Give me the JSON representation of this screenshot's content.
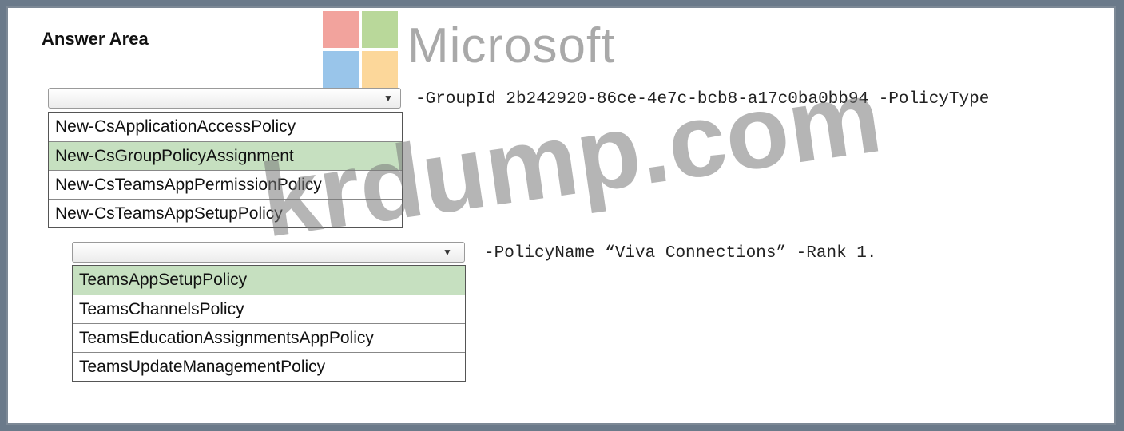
{
  "header": {
    "title": "Answer Area"
  },
  "logo": {
    "word": "Microsoft",
    "colors": [
      "#f2a39d",
      "#b9d89a",
      "#99c5ea",
      "#fcd79a"
    ]
  },
  "watermark": {
    "text": "krdump.com"
  },
  "statement1": {
    "dropdown_icon": "chevron-down-icon",
    "options": [
      "New-CsApplicationAccessPolicy",
      "New-CsGroupPolicyAssignment",
      "New-CsTeamsAppPermissionPolicy",
      "New-CsTeamsAppSetupPolicy"
    ],
    "selected_index": 1,
    "suffix": "-GroupId 2b242920-86ce-4e7c-bcb8-a17c0ba0bb94 -PolicyType"
  },
  "statement2": {
    "dropdown_icon": "chevron-down-icon",
    "options": [
      "TeamsAppSetupPolicy",
      "TeamsChannelsPolicy",
      "TeamsEducationAssignmentsAppPolicy",
      "TeamsUpdateManagementPolicy"
    ],
    "selected_index": 0,
    "suffix": "-PolicyName “Viva Connections” -Rank 1."
  },
  "colors": {
    "selected_bg": "#c6e0c0"
  }
}
